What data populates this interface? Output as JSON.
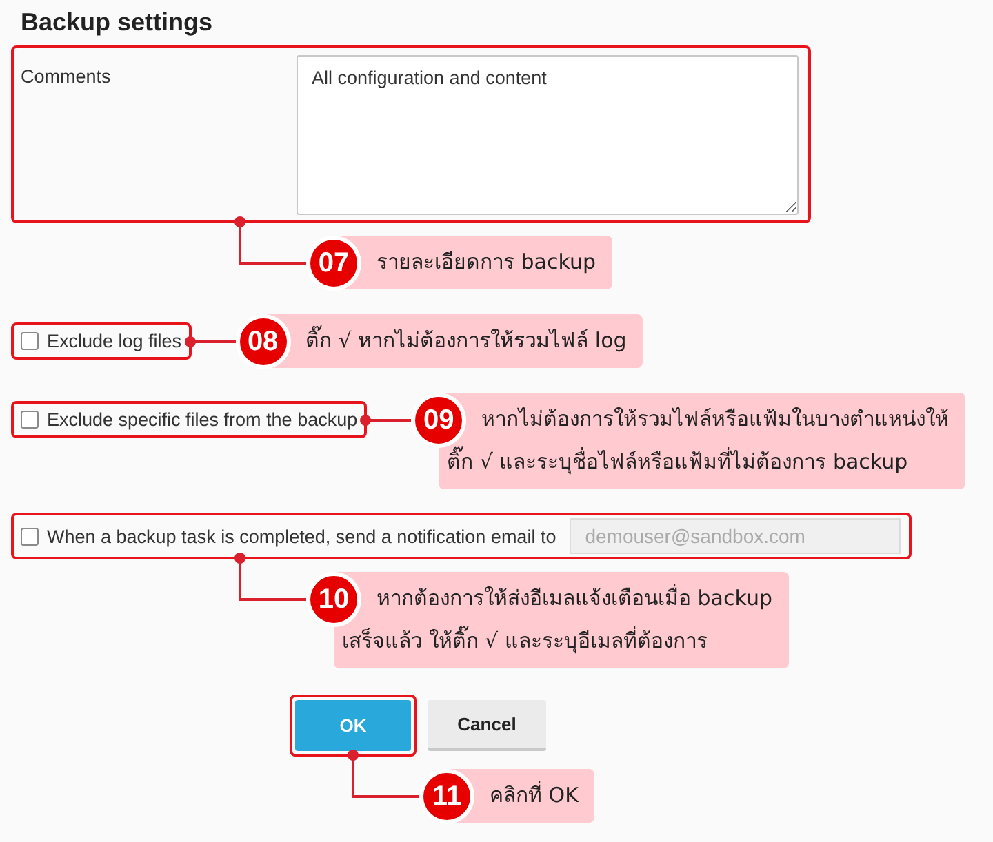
{
  "title": "Backup settings",
  "comments": {
    "label": "Comments",
    "value": "All configuration and content",
    "callout": {
      "number": "07",
      "lines": [
        "รายละเอียดการ backup"
      ]
    }
  },
  "options": [
    {
      "kind": "checkbox",
      "label": "Exclude log files",
      "checked": false,
      "callout": {
        "number": "08",
        "lines": [
          "ติ๊ก √ หากไม่ต้องการให้รวมไฟล์ log"
        ]
      }
    },
    {
      "kind": "checkbox",
      "label": "Exclude specific files from the backup",
      "checked": false,
      "callout": {
        "number": "09",
        "lines": [
          "หากไม่ต้องการให้รวมไฟล์หรือแฟ้มในบางตำแหน่งให้",
          "ติ๊ก √ และระบุชื่อไฟล์หรือแฟ้มที่ไม่ต้องการ backup"
        ]
      }
    },
    {
      "kind": "email",
      "label": "When a backup task is completed, send a notification email to",
      "checked": false,
      "email": {
        "value": "demouser@sandbox.com",
        "disabled": true
      },
      "callout": {
        "number": "10",
        "lines": [
          "หากต้องการให้ส่งอีเมลแจ้งเตือนเมื่อ backup",
          "เสร็จแล้ว ให้ติ๊ก √ และระบุอีเมลที่ต้องการ"
        ]
      }
    }
  ],
  "buttons": [
    {
      "label": "OK",
      "kind": "confirm",
      "callout": {
        "number": "11",
        "lines": [
          "คลิกที่ OK"
        ]
      }
    },
    {
      "label": "Cancel",
      "kind": "cancel"
    }
  ]
}
